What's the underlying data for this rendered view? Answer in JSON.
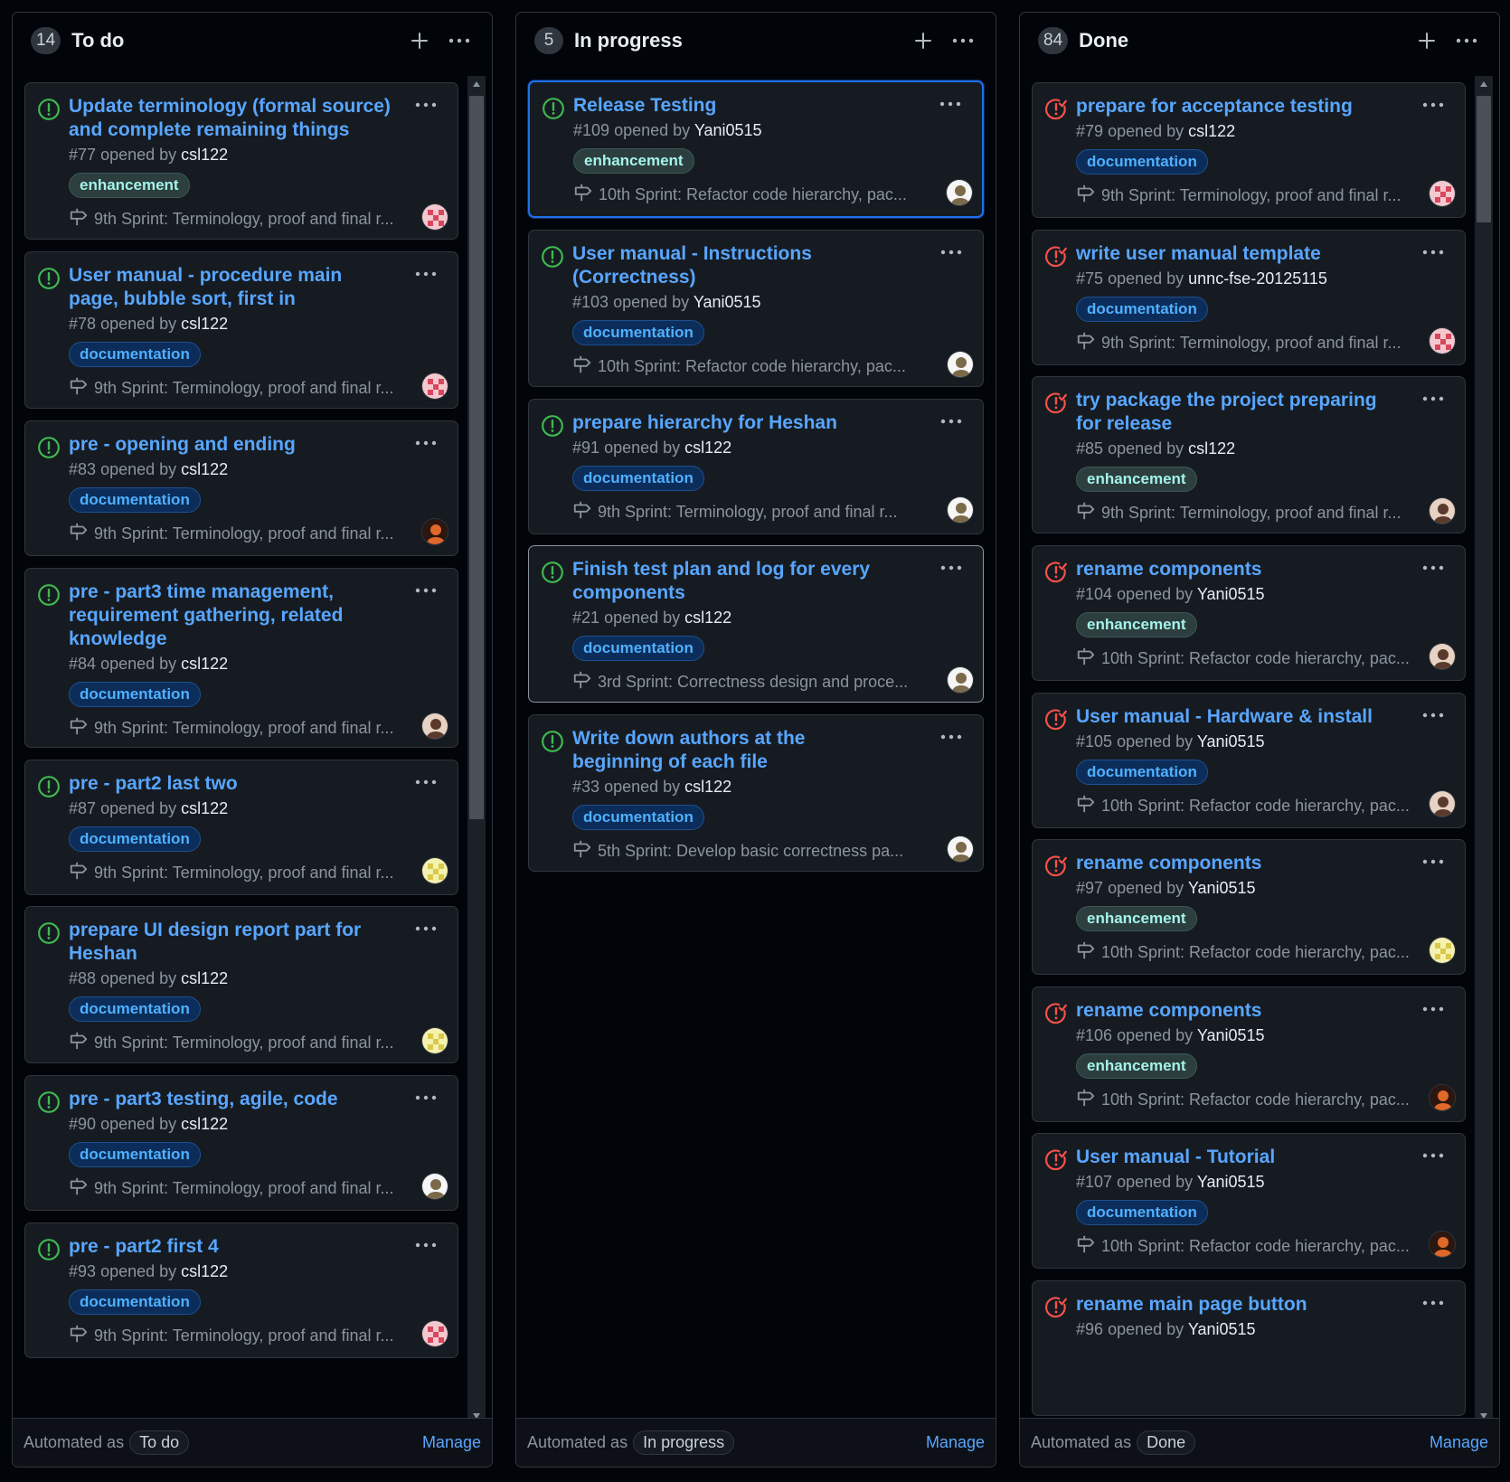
{
  "colors": {
    "open_issue_green": "#3fb950",
    "closed_issue_red": "#f85149",
    "link_blue": "#58a6ff",
    "selected_border": "#1f6feb"
  },
  "icons": {
    "open": "issue-opened-icon",
    "closed": "issue-closed-icon",
    "milestone": "milestone-icon",
    "add": "plus-icon",
    "more": "kebab-horizontal-icon"
  },
  "automated_prefix": "Automated as",
  "opened_by_text": "opened by",
  "columns": [
    {
      "title": "To do",
      "count": "14",
      "automation": "To do",
      "manage": "Manage",
      "cards": [
        {
          "title": "Update terminology (formal source) and complete remaining things",
          "number": "#77",
          "author": "csl122",
          "label": "enhancement",
          "milestone": "9th Sprint: Terminology, proof and final r...",
          "status": "open",
          "avatar": "pink"
        },
        {
          "title": "User manual - procedure main page, bubble sort, first in",
          "number": "#78",
          "author": "csl122",
          "label": "documentation",
          "milestone": "9th Sprint: Terminology, proof and final r...",
          "status": "open",
          "avatar": "pink"
        },
        {
          "title": "pre - opening and ending",
          "number": "#83",
          "author": "csl122",
          "label": "documentation",
          "milestone": "9th Sprint: Terminology, proof and final r...",
          "status": "open",
          "avatar": "orange"
        },
        {
          "title": "pre - part3 time management, requirement gathering, related knowledge",
          "number": "#84",
          "author": "csl122",
          "label": "documentation",
          "milestone": "9th Sprint: Terminology, proof and final r...",
          "status": "open",
          "avatar": "brown"
        },
        {
          "title": "pre - part2 last two",
          "number": "#87",
          "author": "csl122",
          "label": "documentation",
          "milestone": "9th Sprint: Terminology, proof and final r...",
          "status": "open",
          "avatar": "yellow"
        },
        {
          "title": "prepare UI design report part for Heshan",
          "number": "#88",
          "author": "csl122",
          "label": "documentation",
          "milestone": "9th Sprint: Terminology, proof and final r...",
          "status": "open",
          "avatar": "yellow"
        },
        {
          "title": "pre - part3 testing, agile, code",
          "number": "#90",
          "author": "csl122",
          "label": "documentation",
          "milestone": "9th Sprint: Terminology, proof and final r...",
          "status": "open",
          "avatar": "white"
        },
        {
          "title": "pre - part2 first 4",
          "number": "#93",
          "author": "csl122",
          "label": "documentation",
          "milestone": "9th Sprint: Terminology, proof and final r...",
          "status": "open",
          "avatar": "pink"
        }
      ]
    },
    {
      "title": "In progress",
      "count": "5",
      "automation": "In progress",
      "manage": "Manage",
      "cards": [
        {
          "title": "Release Testing",
          "number": "#109",
          "author": "Yani0515",
          "label": "enhancement",
          "milestone": "10th Sprint: Refactor code hierarchy, pac...",
          "status": "open",
          "avatar": "white"
        },
        {
          "title": "User manual - Instructions (Correctness)",
          "number": "#103",
          "author": "Yani0515",
          "label": "documentation",
          "milestone": "10th Sprint: Refactor code hierarchy, pac...",
          "status": "open",
          "avatar": "white"
        },
        {
          "title": "prepare hierarchy for Heshan",
          "number": "#91",
          "author": "csl122",
          "label": "documentation",
          "milestone": "9th Sprint: Terminology, proof and final r...",
          "status": "open",
          "avatar": "white"
        },
        {
          "title": "Finish test plan and log for every components",
          "number": "#21",
          "author": "csl122",
          "label": "documentation",
          "milestone": "3rd Sprint: Correctness design and proce...",
          "status": "open",
          "avatar": "white"
        },
        {
          "title": "Write down authors at the beginning of each file",
          "number": "#33",
          "author": "csl122",
          "label": "documentation",
          "milestone": "5th Sprint: Develop basic correctness pa...",
          "status": "open",
          "avatar": "white"
        }
      ]
    },
    {
      "title": "Done",
      "count": "84",
      "automation": "Done",
      "manage": "Manage",
      "cards": [
        {
          "title": "prepare for acceptance testing",
          "number": "#79",
          "author": "csl122",
          "label": "documentation",
          "milestone": "9th Sprint: Terminology, proof and final r...",
          "status": "closed",
          "avatar": "pink"
        },
        {
          "title": "write user manual template",
          "number": "#75",
          "author": "unnc-fse-20125115",
          "label": "documentation",
          "milestone": "9th Sprint: Terminology, proof and final r...",
          "status": "closed",
          "avatar": "pink"
        },
        {
          "title": "try package the project preparing for release",
          "number": "#85",
          "author": "csl122",
          "label": "enhancement",
          "milestone": "9th Sprint: Terminology, proof and final r...",
          "status": "closed",
          "avatar": "brown"
        },
        {
          "title": "rename components",
          "number": "#104",
          "author": "Yani0515",
          "label": "enhancement",
          "milestone": "10th Sprint: Refactor code hierarchy, pac...",
          "status": "closed",
          "avatar": "brown"
        },
        {
          "title": "User manual - Hardware & install",
          "number": "#105",
          "author": "Yani0515",
          "label": "documentation",
          "milestone": "10th Sprint: Refactor code hierarchy, pac...",
          "status": "closed",
          "avatar": "brown"
        },
        {
          "title": "rename components",
          "number": "#97",
          "author": "Yani0515",
          "label": "enhancement",
          "milestone": "10th Sprint: Refactor code hierarchy, pac...",
          "status": "closed",
          "avatar": "yellow"
        },
        {
          "title": "rename components",
          "number": "#106",
          "author": "Yani0515",
          "label": "enhancement",
          "milestone": "10th Sprint: Refactor code hierarchy, pac...",
          "status": "closed",
          "avatar": "orange"
        },
        {
          "title": "User manual - Tutorial",
          "number": "#107",
          "author": "Yani0515",
          "label": "documentation",
          "milestone": "10th Sprint: Refactor code hierarchy, pac...",
          "status": "closed",
          "avatar": "orange"
        },
        {
          "title": "rename main page button",
          "number": "#96",
          "author": "Yani0515",
          "label": "",
          "milestone": "",
          "status": "closed",
          "avatar": "orange"
        }
      ]
    }
  ]
}
